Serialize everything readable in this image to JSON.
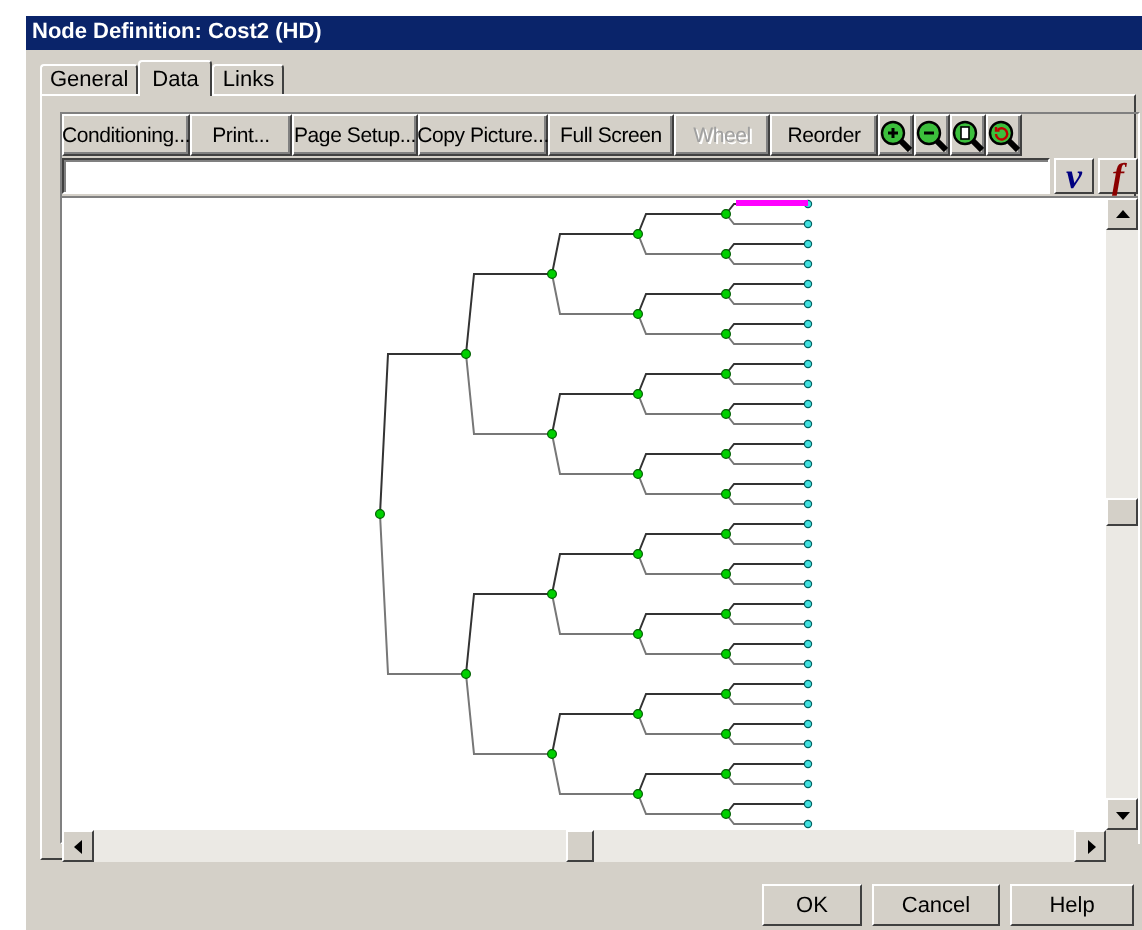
{
  "window": {
    "title": "Node Definition: Cost2 (HD)"
  },
  "tabs": [
    {
      "label": "General",
      "selected": false
    },
    {
      "label": "Data",
      "selected": true
    },
    {
      "label": "Links",
      "selected": false
    }
  ],
  "toolbar": [
    {
      "kind": "text",
      "label": "Conditioning...",
      "disabled": false
    },
    {
      "kind": "text",
      "label": "Print...",
      "disabled": false
    },
    {
      "kind": "text",
      "label": "Page Setup...",
      "disabled": false
    },
    {
      "kind": "text",
      "label": "Copy Picture...",
      "disabled": false
    },
    {
      "kind": "text",
      "label": "Full Screen",
      "disabled": false
    },
    {
      "kind": "text",
      "label": "Wheel",
      "disabled": true
    },
    {
      "kind": "text",
      "label": "Reorder",
      "disabled": false
    },
    {
      "kind": "zoom-in",
      "disabled": false
    },
    {
      "kind": "zoom-out",
      "disabled": false
    },
    {
      "kind": "zoom-page",
      "disabled": false
    },
    {
      "kind": "zoom-back",
      "disabled": false
    }
  ],
  "formula_bar": {
    "value_button": "v",
    "function_button": "f"
  },
  "buttons": [
    "OK",
    "Cancel",
    "Help"
  ]
}
